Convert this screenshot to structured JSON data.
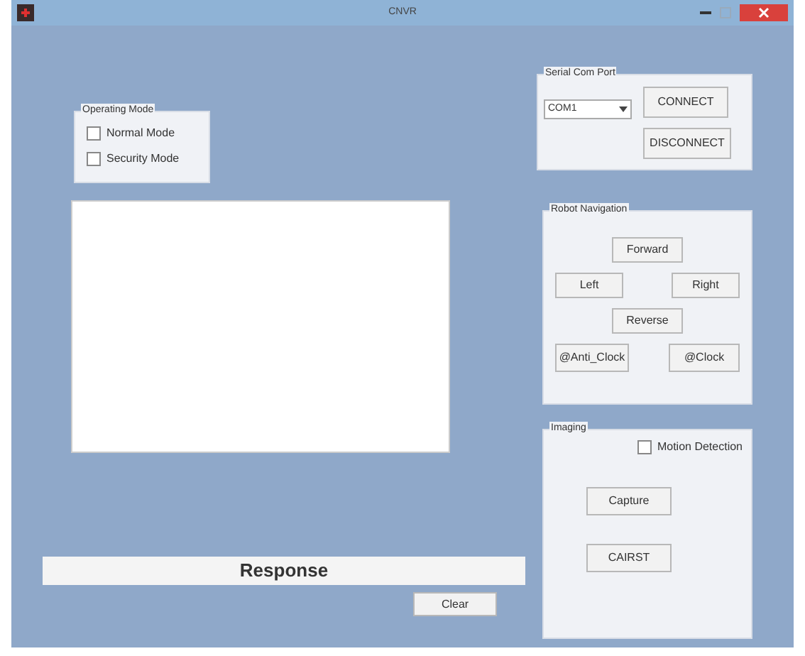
{
  "window": {
    "title": "CNVR"
  },
  "operating_mode": {
    "title": "Operating Mode",
    "options": [
      {
        "label": "Normal Mode",
        "checked": false
      },
      {
        "label": "Security Mode",
        "checked": false
      }
    ]
  },
  "serial_port": {
    "title": "Serial Com Port",
    "port": "COM1",
    "buttons": [
      "CONNECT",
      "DISCONNECT"
    ]
  },
  "robot_navigation": {
    "title": "Robot Navigation",
    "forward": "Forward",
    "left": "Left",
    "right": "Right",
    "reverse": "Reverse",
    "anti_clock": "@Anti_Clock",
    "clock": "@Clock"
  },
  "imaging": {
    "title": "Imaging",
    "motion_detection": {
      "label": "Motion Detection",
      "checked": false
    },
    "buttons": [
      "Capture",
      "CAIRST"
    ]
  },
  "response": "Response",
  "clear_button": "Clear"
}
